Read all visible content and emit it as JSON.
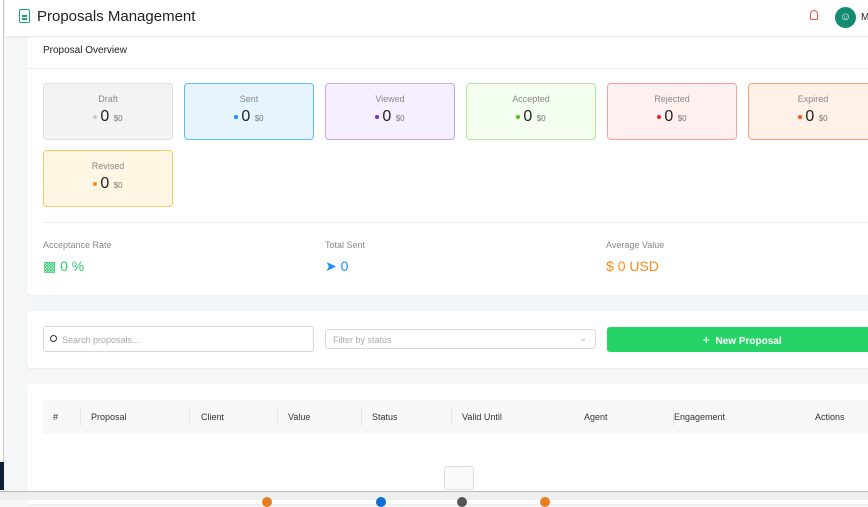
{
  "header": {
    "title": "Proposals Management",
    "user": "Ma",
    "avatar_icon": "user-icon"
  },
  "overview": {
    "title": "Proposal Overview",
    "cards": [
      {
        "label": "Draft",
        "count": "0",
        "amount": "$0",
        "bg": "#f3f3f3",
        "border": "#e0e0e0",
        "dot": "#ccc"
      },
      {
        "label": "Sent",
        "count": "0",
        "amount": "$0",
        "bg": "#e6f4fe",
        "border": "#69b8f5",
        "dot": "#1890ff"
      },
      {
        "label": "Viewed",
        "count": "0",
        "amount": "$0",
        "bg": "#f6efff",
        "border": "#c9a7ee",
        "dot": "#722ed1"
      },
      {
        "label": "Accepted",
        "count": "0",
        "amount": "$0",
        "bg": "#f4fff0",
        "border": "#b2e69b",
        "dot": "#52c41a"
      },
      {
        "label": "Rejected",
        "count": "0",
        "amount": "$0",
        "bg": "#fff0f0",
        "border": "#f5a0a0",
        "dot": "#f5222d"
      },
      {
        "label": "Expired",
        "count": "0",
        "amount": "$0",
        "bg": "#fff1e8",
        "border": "#f9a07a",
        "dot": "#fa541c"
      },
      {
        "label": "Revised",
        "count": "0",
        "amount": "$0",
        "bg": "#fff6e3",
        "border": "#f5c76c",
        "dot": "#fa8c16"
      }
    ],
    "stats": [
      {
        "label": "Acceptance Rate",
        "value": "0 %",
        "icon": "bar-chart-icon",
        "color": "#2ecc71"
      },
      {
        "label": "Total Sent",
        "value": "0",
        "icon": "send-icon",
        "color": "#1890ff"
      },
      {
        "label": "Average Value",
        "value": "0 USD",
        "icon": "dollar-icon",
        "color": "#fa8c16"
      }
    ]
  },
  "filters": {
    "search_placeholder": "Search proposals...",
    "status_placeholder": "Filter by status",
    "new_button": "New Proposal"
  },
  "table": {
    "columns": [
      "#",
      "Proposal",
      "Client",
      "Value",
      "Status",
      "Valid Until",
      "Agent",
      "Engagement",
      "Actions"
    ]
  }
}
